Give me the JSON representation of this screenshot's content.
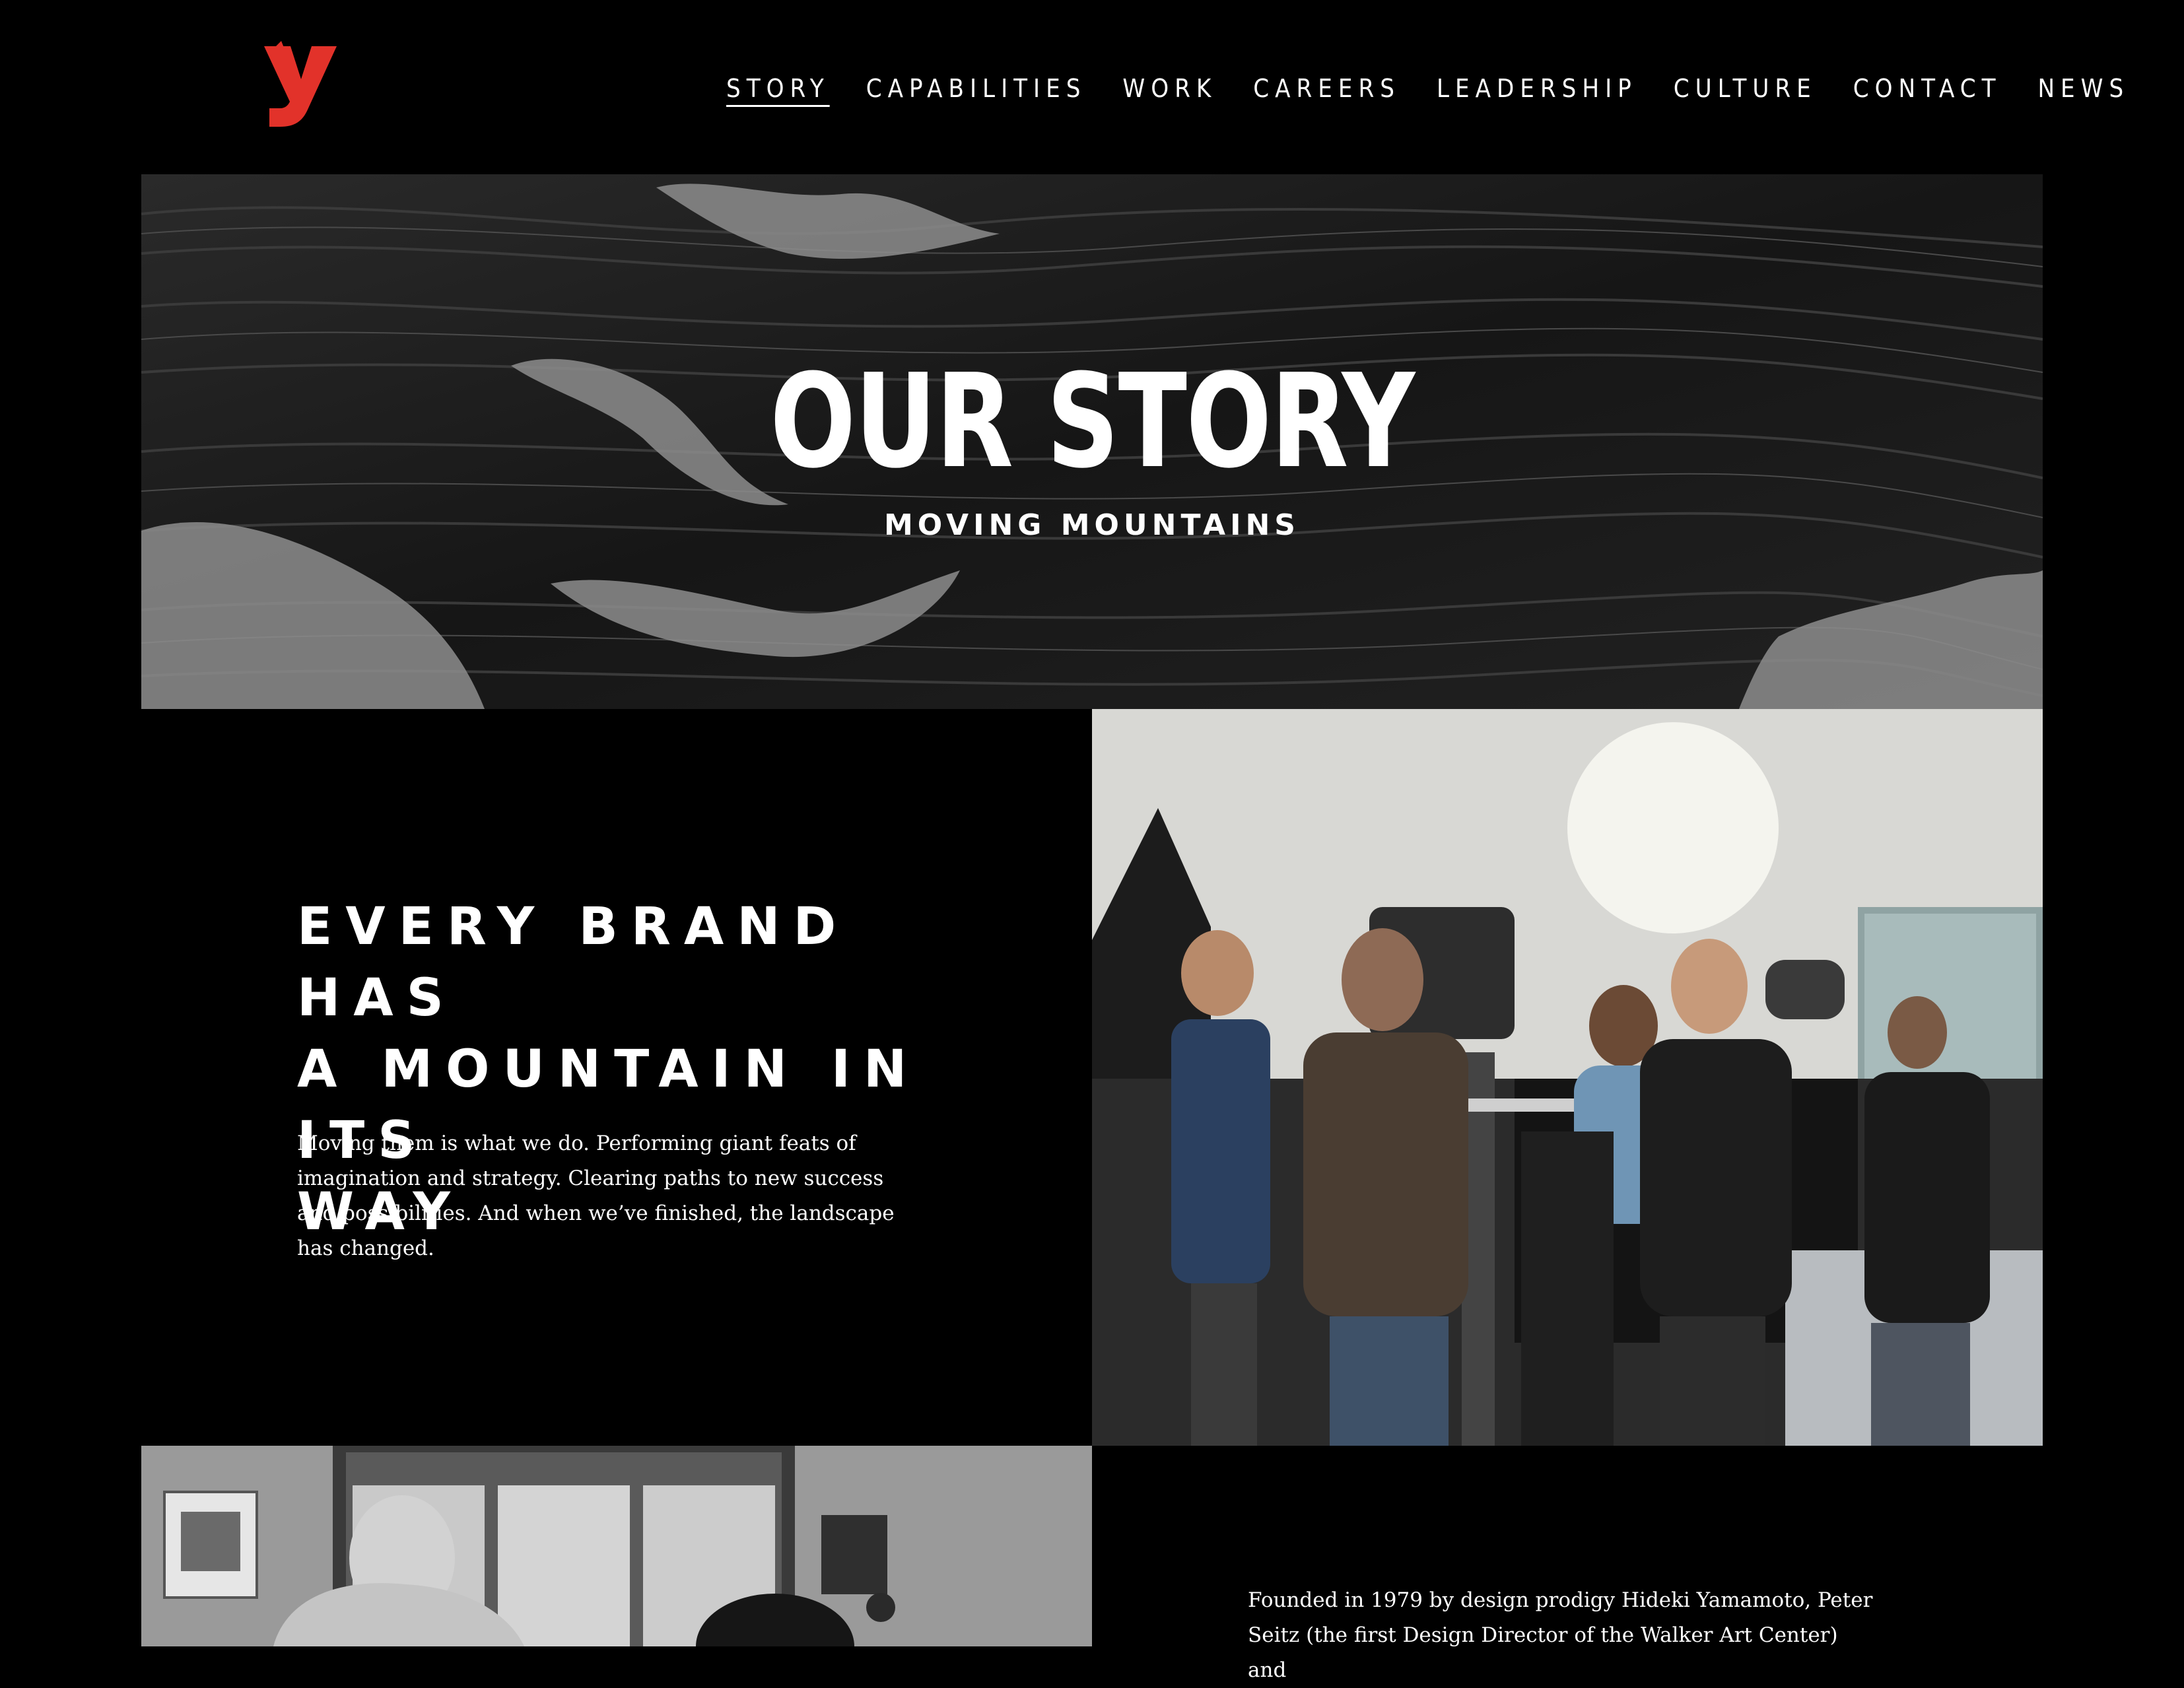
{
  "header": {
    "logo_text": "y",
    "logo_color": "#e2322a",
    "nav": [
      {
        "label": "STORY",
        "active": true
      },
      {
        "label": "CAPABILITIES",
        "active": false
      },
      {
        "label": "WORK",
        "active": false
      },
      {
        "label": "CAREERS",
        "active": false
      },
      {
        "label": "LEADERSHIP",
        "active": false
      },
      {
        "label": "CULTURE",
        "active": false
      },
      {
        "label": "CONTACT",
        "active": false
      },
      {
        "label": "NEWS",
        "active": false
      }
    ]
  },
  "hero": {
    "title": "OUR STORY",
    "subtitle": "MOVING MOUNTAINS"
  },
  "section1": {
    "heading_lines": [
      "EVERY BRAND HAS",
      "A MOUNTAIN IN ITS",
      "WAY"
    ],
    "body": "Moving them is what we do. Performing giant feats of imagination and strategy. Clearing paths to new success and possibilities. And when we’ve finished, the landscape has changed."
  },
  "section2": {
    "body": "Founded in 1979 by design prodigy Hideki Yamamoto, Peter Seitz (the first Design Director of the Walker Art Center) and"
  },
  "colors": {
    "background": "#000000",
    "text": "#ffffff",
    "accent": "#e2322a"
  }
}
